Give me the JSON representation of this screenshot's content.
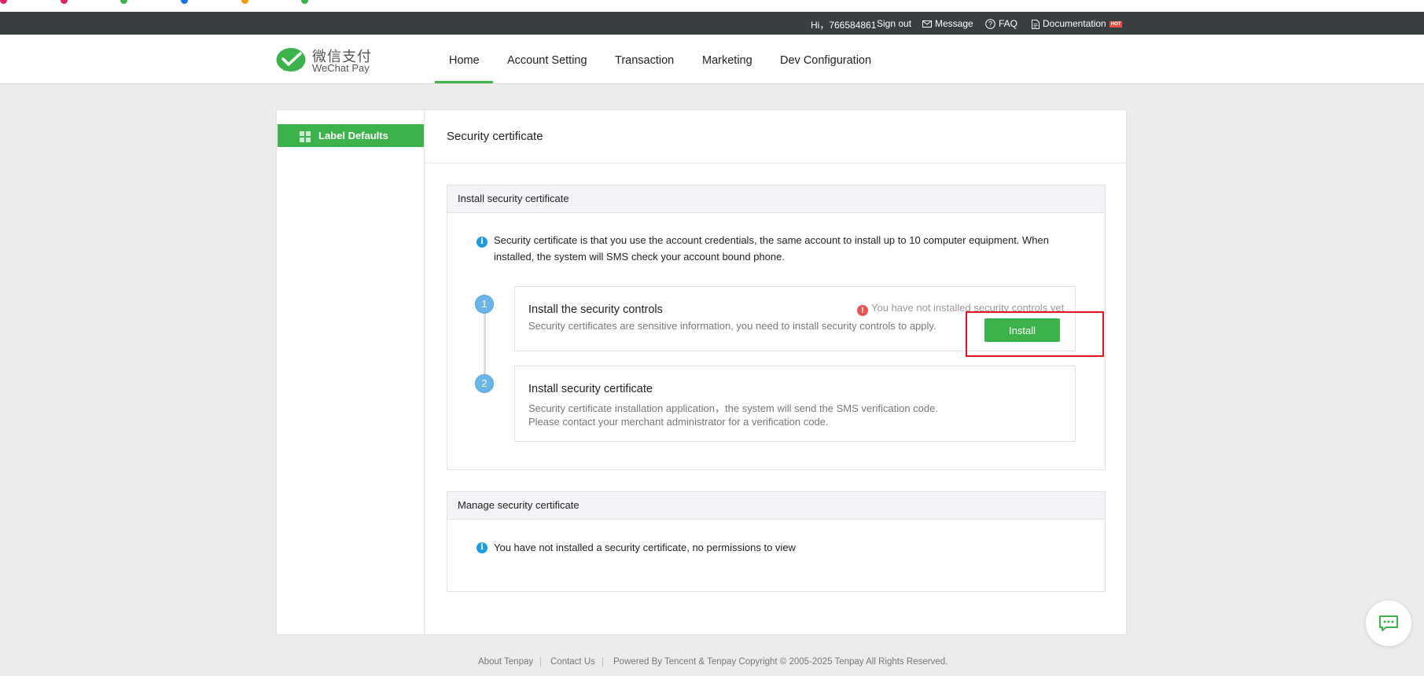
{
  "bookmarks": [],
  "topbar": {
    "greeting": "Hi，766584861",
    "sign_out": "Sign out",
    "message": "Message",
    "faq": "FAQ",
    "documentation": "Documentation",
    "hot_badge": "HOT"
  },
  "brand": {
    "name_cn": "微信支付",
    "name_en": "WeChat Pay",
    "color": "#3cb34a"
  },
  "nav": {
    "items": [
      "Home",
      "Account Setting",
      "Transaction",
      "Marketing",
      "Dev Configuration"
    ],
    "active": "Home"
  },
  "sidebar": {
    "items": [
      {
        "label": "Label Defaults",
        "icon": "grid-icon"
      }
    ]
  },
  "content": {
    "title": "Security certificate",
    "install_section": {
      "header": "Install security certificate",
      "info_text": "Security certificate is that you use the account credentials, the same account to install up to  10  computer equipment. When installed, the system will SMS check your account bound phone.",
      "steps": [
        {
          "number": "1",
          "title": "Install the security controls",
          "desc": "Security certificates are sensitive information, you need to install security controls to apply.",
          "status": "You have not installed security controls yet",
          "button": "Install"
        },
        {
          "number": "2",
          "title": "Install security certificate",
          "desc_line1": "Security certificate installation application，the system will send the SMS verification code.",
          "desc_line2": "Please contact your merchant administrator for a verification code."
        }
      ]
    },
    "manage_section": {
      "header": "Manage security certificate",
      "info_text": "You have not installed a security certificate, no permissions to view"
    }
  },
  "footer": {
    "about": "About Tenpay",
    "contact": "Contact Us",
    "separator": "|",
    "copyright": "Powered By Tencent & Tenpay Copyright © 2005-2025 Tenpay All Rights Reserved."
  },
  "colors": {
    "accent_green": "#3cb34a",
    "topbar_bg": "#393e40",
    "info_blue": "#1b9be0",
    "warning_red": "#e85454",
    "highlight_red": "#e8141c"
  }
}
